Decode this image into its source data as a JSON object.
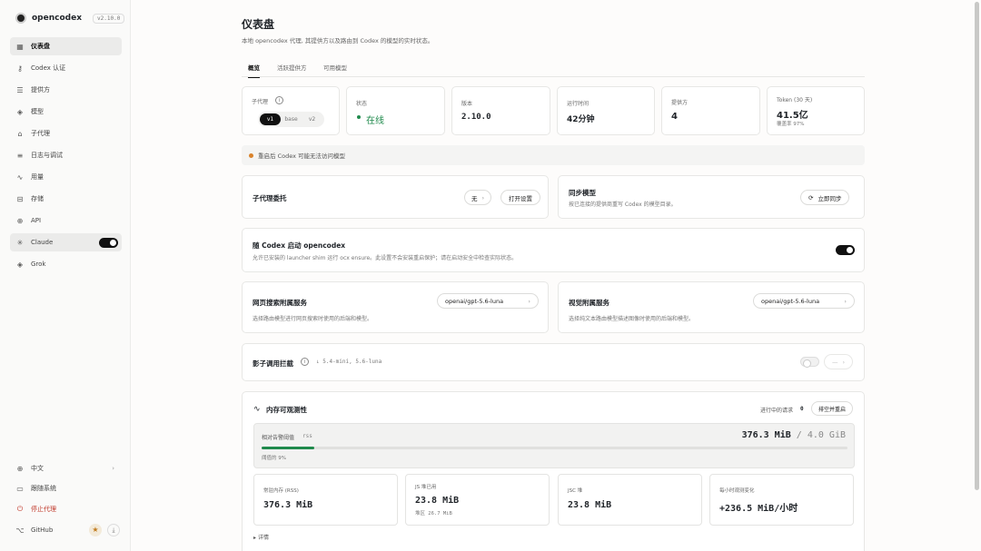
{
  "app": {
    "name": "opencodex",
    "version": "v2.10.0"
  },
  "sidebar": {
    "items": [
      {
        "icon": "grid-icon",
        "label": "仪表盘"
      },
      {
        "icon": "key-icon",
        "label": "Codex 认证"
      },
      {
        "icon": "server-icon",
        "label": "提供方"
      },
      {
        "icon": "cube-icon",
        "label": "模型"
      },
      {
        "icon": "robot-icon",
        "label": "子代理"
      },
      {
        "icon": "list-icon",
        "label": "日志与调试"
      },
      {
        "icon": "activity-icon",
        "label": "用量"
      },
      {
        "icon": "storage-icon",
        "label": "存储"
      },
      {
        "icon": "globe-icon",
        "label": "API"
      },
      {
        "icon": "sparkle-icon",
        "label": "Claude"
      },
      {
        "icon": "cube-icon",
        "label": "Grok"
      }
    ],
    "bottom": {
      "language": "中文",
      "theme": "跟随系统",
      "stop": "停止代理",
      "github": "GitHub"
    }
  },
  "header": {
    "title": "仪表盘",
    "subtitle": "本地 opencodex 代理, 其提供方以及路由到 Codex 的模型的实时状态。"
  },
  "tabs": [
    "概览",
    "活跃提供方",
    "可用模型"
  ],
  "stats": {
    "subagent": {
      "label": "子代理",
      "options": [
        "v1",
        "base",
        "v2"
      ]
    },
    "status": {
      "label": "状态",
      "value": "在线"
    },
    "version": {
      "label": "版本",
      "value": "2.10.0"
    },
    "uptime": {
      "label": "运行时间",
      "value": "42分钟"
    },
    "providers": {
      "label": "提供方",
      "value": "4"
    },
    "tokens": {
      "label": "Token (30 天)",
      "value": "41.5亿",
      "sub": "覆盖率 97%"
    }
  },
  "notice": "重启后 Codex 可能无法访问模型",
  "delegate": {
    "title": "子代理委托",
    "none": "无",
    "open_settings": "打开设置"
  },
  "sync": {
    "title": "同步模型",
    "desc": "按已连接的提供商重写 Codex 的模型目录。",
    "button": "立即同步"
  },
  "launch": {
    "title": "随 Codex 启动 opencodex",
    "desc": "允许已安装的 launcher shim 运行 ocx ensure。此设置不会安装重启保护；请在启动安全中检查实际状态。"
  },
  "websearch": {
    "title": "网页搜索附属服务",
    "model": "openai/gpt-5.6-luna",
    "desc": "选择路由模型进行网页搜索时使用的后端和模型。"
  },
  "vision": {
    "title": "视觉附属服务",
    "model": "openai/gpt-5.6-luna",
    "desc": "选择纯文本路由模型描述图像时使用的后端和模型。"
  },
  "shadow": {
    "title": "影子调用拦截",
    "models": "↓ 5.4-mini, 5.6-luna",
    "dash": "—"
  },
  "memory": {
    "title": "内存可观测性",
    "inflight_label": "进行中的请求",
    "inflight_value": "0",
    "drain_button": "排空并重启",
    "threshold_label": "相对告警阈值",
    "rss_tag": "rss",
    "used": "376.3 MiB",
    "sep": "/",
    "total": "4.0 GiB",
    "threshold_pct": "阈值的 9%",
    "fill_fraction": 0.09,
    "cards": [
      {
        "label": "常驻内存 (RSS)",
        "value": "376.3 MiB",
        "sub": ""
      },
      {
        "label": "JS 堆已用",
        "value": "23.8 MiB",
        "sub": "堆区 26.7 MiB"
      },
      {
        "label": "JSC 堆",
        "value": "23.8 MiB",
        "sub": ""
      },
      {
        "label": "每小时观测变化",
        "value": "+236.5 MiB/小时",
        "sub": ""
      }
    ],
    "details": "详情"
  }
}
